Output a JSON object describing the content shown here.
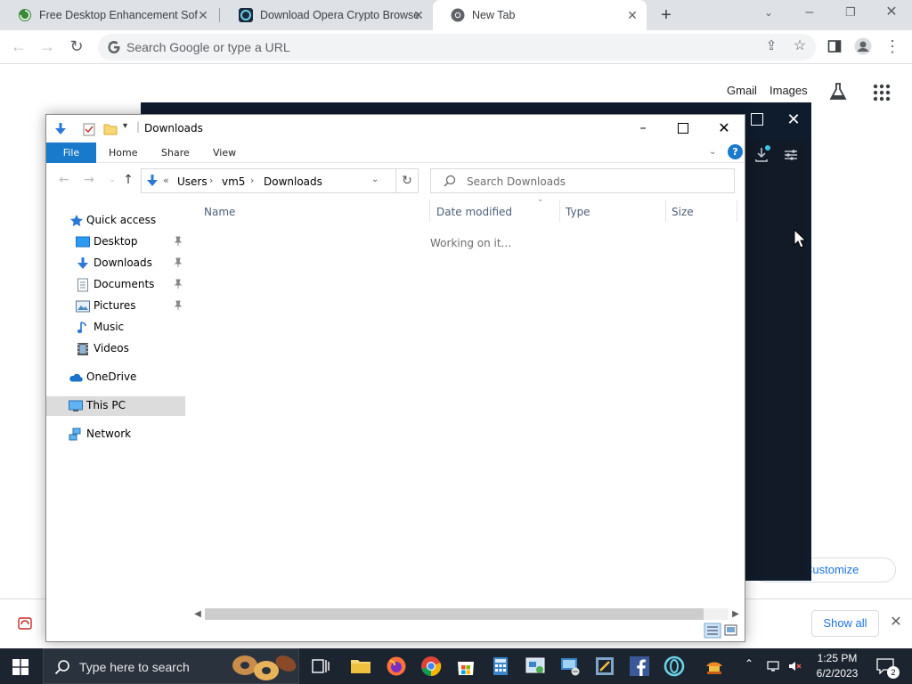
{
  "browser": {
    "tabs": [
      {
        "title": "Free Desktop Enhancement Softw",
        "favicon": "spiral-icon"
      },
      {
        "title": "Download Opera Crypto Browser",
        "favicon": "opera-crypto-icon"
      },
      {
        "title": "New Tab",
        "favicon": "chrome-icon"
      }
    ],
    "omnibox_placeholder": "Search Google or type a URL",
    "ntp": {
      "gmail": "Gmail",
      "images": "Images",
      "customize": "Customize Chrome"
    },
    "shelf": {
      "show_all": "Show all"
    }
  },
  "explorer": {
    "title": "Downloads",
    "ribbon_tabs": [
      "File",
      "Home",
      "Share",
      "View"
    ],
    "breadcrumb": [
      "Users",
      "vm5",
      "Downloads"
    ],
    "breadcrumb_prefix": "«",
    "search_placeholder": "Search Downloads",
    "nav": {
      "quick_access": "Quick access",
      "items": [
        "Desktop",
        "Downloads",
        "Documents",
        "Pictures",
        "Music",
        "Videos"
      ],
      "onedrive": "OneDrive",
      "thispc": "This PC",
      "network": "Network"
    },
    "columns": [
      "Name",
      "Date modified",
      "Type",
      "Size"
    ],
    "status": "Working on it..."
  },
  "taskbar": {
    "search_placeholder": "Type here to search",
    "time": "1:25 PM",
    "date": "6/2/2023",
    "notifications": "2"
  },
  "colors": {
    "accent": "#1979ca",
    "opera_bg": "#0f1c2e",
    "taskbar_bg": "#1c2430",
    "link": "#1a73e8"
  }
}
